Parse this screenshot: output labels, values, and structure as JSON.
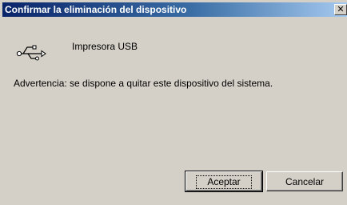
{
  "window": {
    "title": "Confirmar la eliminación del dispositivo",
    "close_glyph": "✕"
  },
  "device": {
    "icon": "usb-icon",
    "name": "Impresora USB"
  },
  "message": {
    "warning": "Advertencia: se dispone a quitar este dispositivo del sistema."
  },
  "buttons": {
    "ok_label": "Aceptar",
    "cancel_label": "Cancelar"
  },
  "colors": {
    "titlebar_start": "#0a246a",
    "titlebar_end": "#a6caf0",
    "face": "#d4d0c8"
  }
}
